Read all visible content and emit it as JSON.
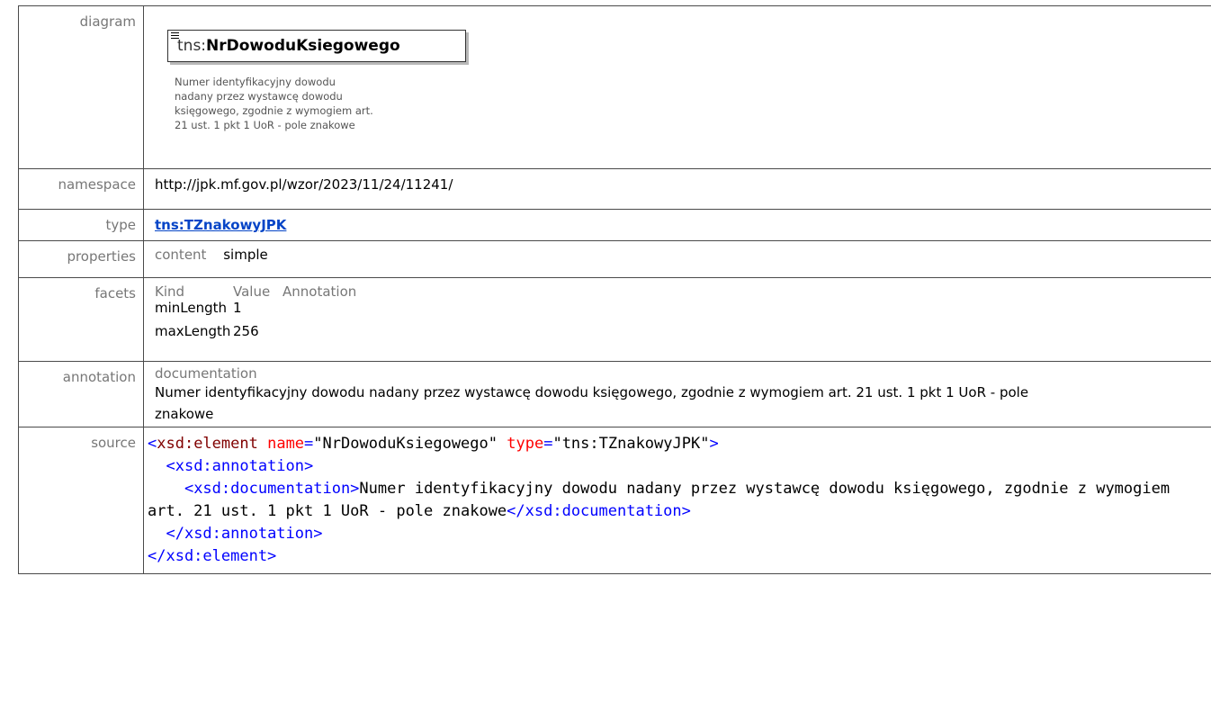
{
  "rows": {
    "diagram": {
      "label": "diagram",
      "element_prefix": "tns:",
      "element_name": "NrDowoduKsiegowego",
      "doc_lines": [
        "Numer identyfikacyjny dowodu",
        "nadany przez wystawcę dowodu",
        "księgowego, zgodnie z wymogiem art.",
        "21 ust. 1 pkt 1 UoR - pole znakowe"
      ]
    },
    "namespace": {
      "label": "namespace",
      "value": "http://jpk.mf.gov.pl/wzor/2023/11/24/11241/"
    },
    "type": {
      "label": "type",
      "value": "tns:TZnakowyJPK"
    },
    "properties": {
      "label": "properties",
      "key": "content",
      "value": "simple"
    },
    "facets": {
      "label": "facets",
      "headers": [
        "Kind",
        "Value",
        "Annotation"
      ],
      "rows": [
        {
          "kind": "minLength",
          "value": "1",
          "annotation": ""
        },
        {
          "kind": "maxLength",
          "value": "256",
          "annotation": ""
        }
      ]
    },
    "annotation": {
      "label": "annotation",
      "heading": "documentation",
      "text": "Numer identyfikacyjny dowodu nadany przez wystawcę dowodu księgowego, zgodnie z wymogiem art. 21 ust. 1 pkt 1 UoR - pole znakowe"
    },
    "source": {
      "label": "source",
      "open_tag": "<xsd:element",
      "attr1_name": "name",
      "attr1_value": "\"NrDowoduKsiegowego\"",
      "attr2_name": "type",
      "attr2_value": "\"tns:TZnakowyJPK\"",
      "annotation_open": "<xsd:annotation>",
      "documentation_open": "<xsd:documentation>",
      "documentation_text": "Numer identyfikacyjny dowodu nadany przez wystawcę dowodu księgowego, zgodnie z wymogiem art. 21 ust. 1 pkt 1 UoR - pole znakowe",
      "documentation_close": "</xsd:documentation>",
      "annotation_close": "</xsd:annotation>",
      "element_close": "</xsd:element>"
    }
  },
  "colors": {
    "link": "#0645c7",
    "label": "#777777",
    "xml_bracket": "#0000ff",
    "xml_tag": "#800000",
    "xml_attr": "#ff0000"
  }
}
